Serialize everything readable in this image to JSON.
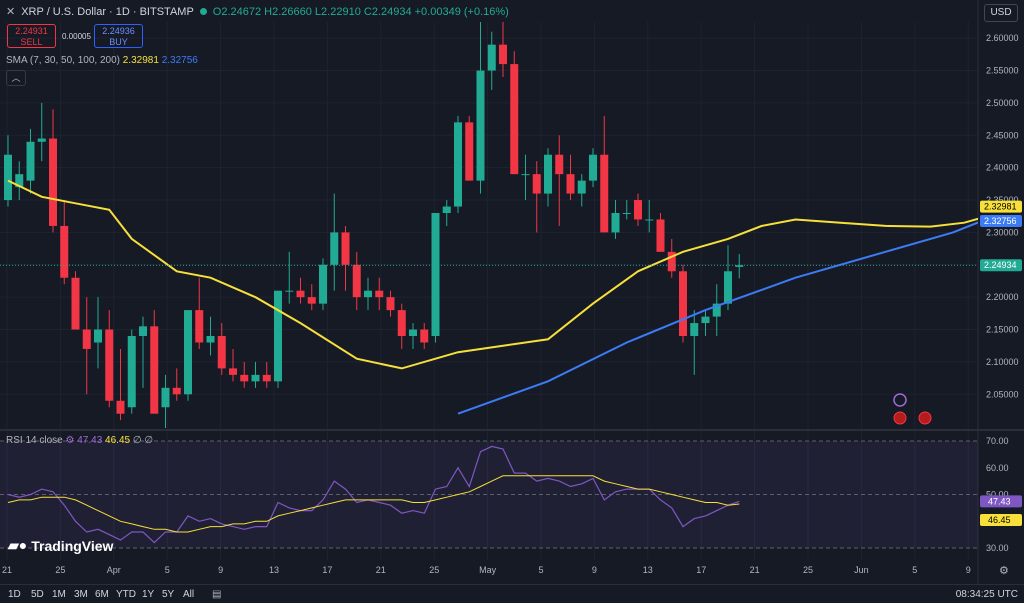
{
  "header": {
    "symbol": "XRP / U.S. Dollar · 1D · BITSTAMP",
    "ohlc": "O2.24672 H2.26660 L2.22910 C2.24934 +0.00349 (+0.16%)",
    "sell_price": "2.24931",
    "sell_label": "SELL",
    "spread": "0.00005",
    "buy_price": "2.24936",
    "buy_label": "BUY",
    "currency": "USD"
  },
  "sma_legend": {
    "label": "SMA (7, 30, 50, 100, 200)",
    "value1": "2.32981",
    "value2": "2.32756"
  },
  "rsi_legend": {
    "label": "RSI 14 close",
    "rsi_value": "47.43",
    "ma_value": "46.45",
    "tail": "∅ ∅"
  },
  "logo_text": "TradingView",
  "timeframes": [
    "1D",
    "5D",
    "1M",
    "3M",
    "6M",
    "YTD",
    "1Y",
    "5Y",
    "All"
  ],
  "clock": "08:34:25 UTC",
  "colors": {
    "background": "#161a25",
    "up": "#22ab94",
    "down": "#f23645",
    "sma_fast": "#f7e03a",
    "sma_slow": "#3b7cf6",
    "rsi": "#7e57c2",
    "text": "#d1d4dc"
  },
  "chart_data": [
    {
      "type": "candlestick",
      "title": "XRP / U.S. Dollar · 1D · BITSTAMP",
      "ylim": [
        2.02,
        2.65
      ],
      "y_ticks": [
        "2.60000",
        "2.55000",
        "2.50000",
        "2.45000",
        "2.40000",
        "2.35000",
        "2.30000",
        "2.25000",
        "2.20000",
        "2.15000",
        "2.10000",
        "2.05000"
      ],
      "x_ticks": [
        "21",
        "25",
        "Apr",
        "5",
        "9",
        "13",
        "17",
        "21",
        "25",
        "May",
        "5",
        "9",
        "13",
        "17",
        "21",
        "25",
        "Jun",
        "5",
        "9"
      ],
      "candles": [
        {
          "o": 2.35,
          "h": 2.45,
          "l": 2.34,
          "c": 2.42
        },
        {
          "o": 2.37,
          "h": 2.41,
          "l": 2.35,
          "c": 2.39
        },
        {
          "o": 2.38,
          "h": 2.46,
          "l": 2.36,
          "c": 2.44
        },
        {
          "o": 2.44,
          "h": 2.5,
          "l": 2.41,
          "c": 2.445
        },
        {
          "o": 2.445,
          "h": 2.49,
          "l": 2.3,
          "c": 2.31
        },
        {
          "o": 2.31,
          "h": 2.35,
          "l": 2.22,
          "c": 2.23
        },
        {
          "o": 2.23,
          "h": 2.24,
          "l": 2.15,
          "c": 2.15
        },
        {
          "o": 2.15,
          "h": 2.2,
          "l": 2.05,
          "c": 2.12
        },
        {
          "o": 2.13,
          "h": 2.2,
          "l": 2.09,
          "c": 2.15
        },
        {
          "o": 2.15,
          "h": 2.18,
          "l": 2.03,
          "c": 2.04
        },
        {
          "o": 2.04,
          "h": 2.12,
          "l": 2.01,
          "c": 2.02
        },
        {
          "o": 2.03,
          "h": 2.15,
          "l": 2.02,
          "c": 2.14
        },
        {
          "o": 2.14,
          "h": 2.17,
          "l": 2.06,
          "c": 2.155
        },
        {
          "o": 2.155,
          "h": 2.18,
          "l": 2.05,
          "c": 2.02
        },
        {
          "o": 2.03,
          "h": 2.08,
          "l": 1.95,
          "c": 2.06
        },
        {
          "o": 2.06,
          "h": 2.09,
          "l": 2.04,
          "c": 2.05
        },
        {
          "o": 2.05,
          "h": 2.12,
          "l": 2.04,
          "c": 2.18
        },
        {
          "o": 2.18,
          "h": 2.23,
          "l": 2.12,
          "c": 2.13
        },
        {
          "o": 2.13,
          "h": 2.17,
          "l": 2.11,
          "c": 2.14
        },
        {
          "o": 2.14,
          "h": 2.16,
          "l": 2.08,
          "c": 2.09
        },
        {
          "o": 2.09,
          "h": 2.12,
          "l": 2.07,
          "c": 2.08
        },
        {
          "o": 2.08,
          "h": 2.1,
          "l": 2.06,
          "c": 2.07
        },
        {
          "o": 2.07,
          "h": 2.1,
          "l": 2.06,
          "c": 2.08
        },
        {
          "o": 2.08,
          "h": 2.1,
          "l": 2.06,
          "c": 2.07
        },
        {
          "o": 2.07,
          "h": 2.13,
          "l": 2.06,
          "c": 2.21
        },
        {
          "o": 2.21,
          "h": 2.27,
          "l": 2.19,
          "c": 2.21
        },
        {
          "o": 2.21,
          "h": 2.23,
          "l": 2.19,
          "c": 2.2
        },
        {
          "o": 2.2,
          "h": 2.22,
          "l": 2.18,
          "c": 2.19
        },
        {
          "o": 2.19,
          "h": 2.26,
          "l": 2.18,
          "c": 2.25
        },
        {
          "o": 2.25,
          "h": 2.36,
          "l": 2.21,
          "c": 2.3
        },
        {
          "o": 2.3,
          "h": 2.31,
          "l": 2.21,
          "c": 2.25
        },
        {
          "o": 2.25,
          "h": 2.27,
          "l": 2.18,
          "c": 2.2
        },
        {
          "o": 2.2,
          "h": 2.23,
          "l": 2.18,
          "c": 2.21
        },
        {
          "o": 2.21,
          "h": 2.23,
          "l": 2.18,
          "c": 2.2
        },
        {
          "o": 2.2,
          "h": 2.21,
          "l": 2.17,
          "c": 2.18
        },
        {
          "o": 2.18,
          "h": 2.19,
          "l": 2.12,
          "c": 2.14
        },
        {
          "o": 2.14,
          "h": 2.16,
          "l": 2.12,
          "c": 2.15
        },
        {
          "o": 2.15,
          "h": 2.16,
          "l": 2.12,
          "c": 2.13
        },
        {
          "o": 2.14,
          "h": 2.33,
          "l": 2.13,
          "c": 2.33
        },
        {
          "o": 2.33,
          "h": 2.35,
          "l": 2.31,
          "c": 2.34
        },
        {
          "o": 2.34,
          "h": 2.48,
          "l": 2.33,
          "c": 2.47
        },
        {
          "o": 2.47,
          "h": 2.48,
          "l": 2.38,
          "c": 2.38
        },
        {
          "o": 2.38,
          "h": 2.65,
          "l": 2.36,
          "c": 2.55
        },
        {
          "o": 2.55,
          "h": 2.61,
          "l": 2.52,
          "c": 2.59
        },
        {
          "o": 2.59,
          "h": 2.65,
          "l": 2.54,
          "c": 2.56
        },
        {
          "o": 2.56,
          "h": 2.58,
          "l": 2.39,
          "c": 2.39
        },
        {
          "o": 2.39,
          "h": 2.42,
          "l": 2.35,
          "c": 2.39
        },
        {
          "o": 2.39,
          "h": 2.41,
          "l": 2.3,
          "c": 2.36
        },
        {
          "o": 2.36,
          "h": 2.43,
          "l": 2.34,
          "c": 2.42
        },
        {
          "o": 2.42,
          "h": 2.45,
          "l": 2.31,
          "c": 2.39
        },
        {
          "o": 2.39,
          "h": 2.42,
          "l": 2.35,
          "c": 2.36
        },
        {
          "o": 2.36,
          "h": 2.39,
          "l": 2.34,
          "c": 2.38
        },
        {
          "o": 2.38,
          "h": 2.43,
          "l": 2.37,
          "c": 2.42
        },
        {
          "o": 2.42,
          "h": 2.48,
          "l": 2.3,
          "c": 2.3
        },
        {
          "o": 2.3,
          "h": 2.35,
          "l": 2.29,
          "c": 2.33
        },
        {
          "o": 2.33,
          "h": 2.35,
          "l": 2.32,
          "c": 2.33
        },
        {
          "o": 2.35,
          "h": 2.36,
          "l": 2.31,
          "c": 2.32
        },
        {
          "o": 2.32,
          "h": 2.35,
          "l": 2.3,
          "c": 2.32
        },
        {
          "o": 2.32,
          "h": 2.33,
          "l": 2.27,
          "c": 2.27
        },
        {
          "o": 2.27,
          "h": 2.29,
          "l": 2.23,
          "c": 2.24
        },
        {
          "o": 2.24,
          "h": 2.25,
          "l": 2.13,
          "c": 2.14
        },
        {
          "o": 2.14,
          "h": 2.18,
          "l": 2.08,
          "c": 2.16
        },
        {
          "o": 2.16,
          "h": 2.18,
          "l": 2.14,
          "c": 2.17
        },
        {
          "o": 2.17,
          "h": 2.22,
          "l": 2.14,
          "c": 2.19
        },
        {
          "o": 2.19,
          "h": 2.28,
          "l": 2.18,
          "c": 2.24
        },
        {
          "o": 2.24672,
          "h": 2.2666,
          "l": 2.2291,
          "c": 2.24934
        }
      ],
      "series": [
        {
          "name": "SMA value 1",
          "value_label": "2.32981",
          "values": [
            [
              0,
              2.38
            ],
            [
              3,
              2.355
            ],
            [
              6,
              2.345
            ],
            [
              9,
              2.335
            ],
            [
              11,
              2.29
            ],
            [
              15,
              2.24
            ],
            [
              18,
              2.23
            ],
            [
              22,
              2.2
            ],
            [
              26,
              2.16
            ],
            [
              31,
              2.105
            ],
            [
              35,
              2.09
            ],
            [
              40,
              2.115
            ],
            [
              44,
              2.125
            ],
            [
              48,
              2.135
            ],
            [
              52,
              2.19
            ],
            [
              56,
              2.24
            ],
            [
              60,
              2.27
            ],
            [
              64,
              2.29
            ],
            [
              67,
              2.31
            ],
            [
              70,
              2.32
            ],
            [
              74,
              2.315
            ],
            [
              78,
              2.31
            ],
            [
              82,
              2.309
            ],
            [
              85,
              2.315
            ],
            [
              88,
              2.3298
            ]
          ]
        },
        {
          "name": "SMA value 2",
          "value_label": "2.32756",
          "values": [
            [
              40,
              2.02
            ],
            [
              48,
              2.07
            ],
            [
              55,
              2.13
            ],
            [
              62,
              2.18
            ],
            [
              70,
              2.23
            ],
            [
              78,
              2.27
            ],
            [
              84,
              2.3
            ],
            [
              88,
              2.3276
            ]
          ]
        }
      ],
      "last_price": "2.24934"
    },
    {
      "type": "line",
      "title": "RSI 14 close",
      "ylim": [
        30,
        70
      ],
      "y_ticks": [
        "70.00",
        "60.00",
        "50.00",
        "30.00"
      ],
      "bands": [
        30,
        50,
        70
      ],
      "series": [
        {
          "name": "RSI",
          "value_label": "47.43",
          "values": [
            50,
            49,
            50,
            52,
            51,
            46,
            40,
            36,
            37,
            35,
            33,
            36,
            36,
            32,
            36,
            36,
            42,
            40,
            41,
            39,
            38,
            37,
            38,
            38,
            47,
            45,
            44,
            44,
            48,
            55,
            52,
            47,
            48,
            47,
            46,
            43,
            44,
            43,
            52,
            53,
            60,
            53,
            66,
            68,
            67,
            58,
            58,
            55,
            56,
            55,
            53,
            54,
            56,
            48,
            51,
            52,
            52,
            52,
            48,
            45,
            38,
            41,
            42,
            44,
            46,
            47.43
          ]
        },
        {
          "name": "RSI-based MA",
          "value_label": "46.45",
          "values": [
            47,
            48,
            48,
            49,
            49,
            49,
            48,
            46,
            44,
            42,
            40,
            39,
            38,
            37,
            37,
            36,
            36,
            37,
            38,
            38,
            39,
            39,
            40,
            40,
            42,
            43,
            44,
            45,
            46,
            47,
            48,
            48,
            48,
            48,
            48,
            48,
            47,
            47,
            48,
            49,
            50,
            51,
            53,
            55,
            57,
            57,
            57,
            57,
            57,
            57,
            57,
            57,
            57,
            55,
            54,
            53,
            52,
            52,
            51,
            50,
            49,
            48,
            47,
            47,
            46,
            46.45
          ]
        }
      ],
      "x_ticks": [
        "21",
        "25",
        "Apr",
        "5",
        "9",
        "13",
        "17",
        "21",
        "25",
        "May",
        "5",
        "9",
        "13",
        "17",
        "21",
        "25",
        "Jun",
        "5",
        "9"
      ]
    }
  ]
}
